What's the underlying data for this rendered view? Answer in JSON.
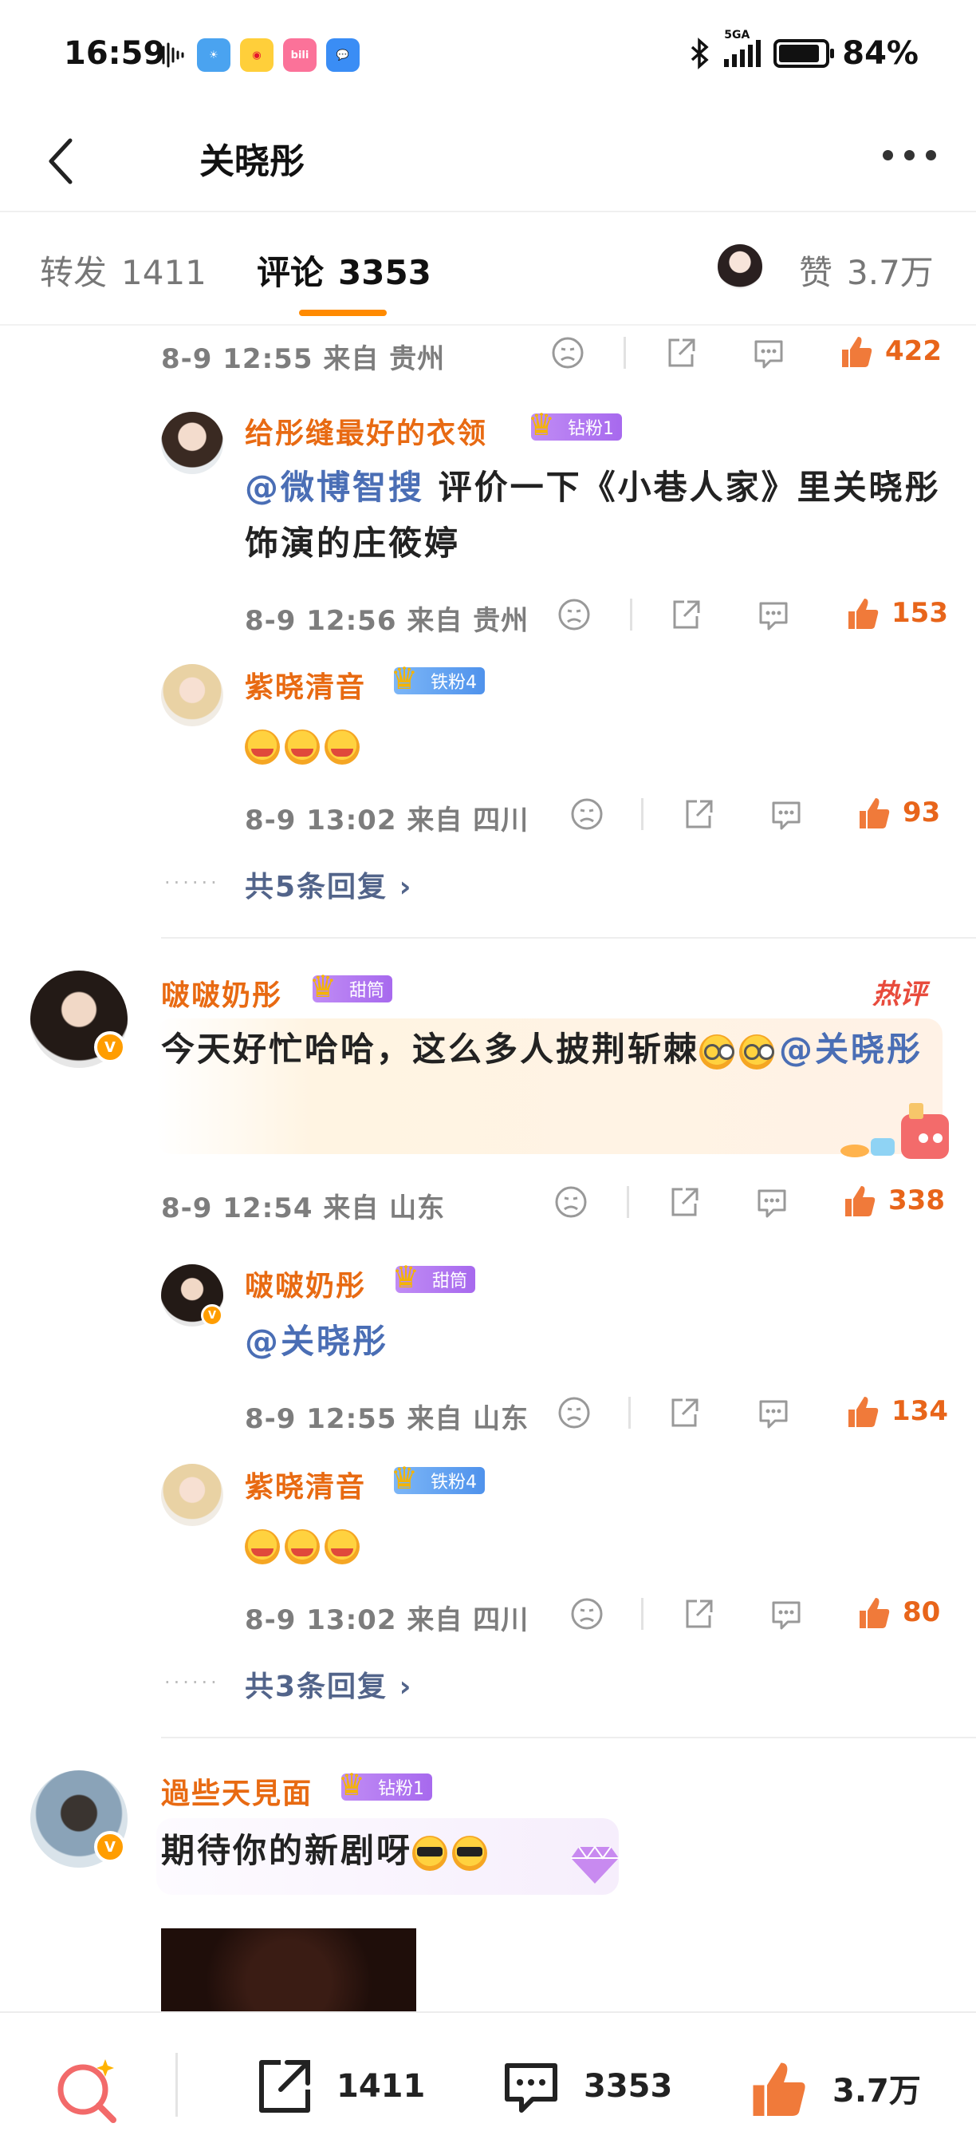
{
  "status_bar": {
    "time": "16:59",
    "network": "5GA",
    "battery": "84%",
    "apps": [
      "weather",
      "weibo",
      "bilibili",
      "messages"
    ]
  },
  "header": {
    "title": "关晓彤"
  },
  "tabs": [
    {
      "label": "转发",
      "count": "1411"
    },
    {
      "label": "评论",
      "count": "3353"
    },
    {
      "label": "赞",
      "count": "3.7万"
    }
  ],
  "comments": {
    "c0": {
      "meta": "8-9 12:55 来自 贵州",
      "likes": "422"
    },
    "c0r1": {
      "user": "给彤缝最好的衣领",
      "badge": "钻粉1",
      "mention": "@微博智搜",
      "text": "评价一下《小巷人家》里关晓彤饰演的庄筱婷",
      "meta": "8-9 12:56 来自 贵州",
      "likes": "153"
    },
    "c0r2": {
      "user": "紫晓清音",
      "badge": "铁粉4",
      "meta": "8-9 13:02 来自 四川",
      "likes": "93"
    },
    "c0_more": "共5条回复",
    "c1": {
      "user": "啵啵奶彤",
      "badge": "甜筒",
      "hot": "热评",
      "text": "今天好忙哈哈，这么多人披荆斩棘",
      "mention": "@关晓彤",
      "meta": "8-9 12:54 来自 山东",
      "likes": "338"
    },
    "c1r1": {
      "user": "啵啵奶彤",
      "badge": "甜筒",
      "mention": "@关晓彤",
      "meta": "8-9 12:55 来自 山东",
      "likes": "134"
    },
    "c1r2": {
      "user": "紫晓清音",
      "badge": "铁粉4",
      "meta": "8-9 13:02 来自 四川",
      "likes": "80"
    },
    "c1_more": "共3条回复",
    "c2": {
      "user": "過些天見面",
      "badge": "钻粉1",
      "text": "期待你的新剧呀"
    }
  },
  "bottom_bar": {
    "reposts": "1411",
    "comments": "3353",
    "likes": "3.7万"
  },
  "colors": {
    "accent": "#ff8a00",
    "username": "#e86a12",
    "like": "#e8651a",
    "mention": "#4a6eb5"
  }
}
